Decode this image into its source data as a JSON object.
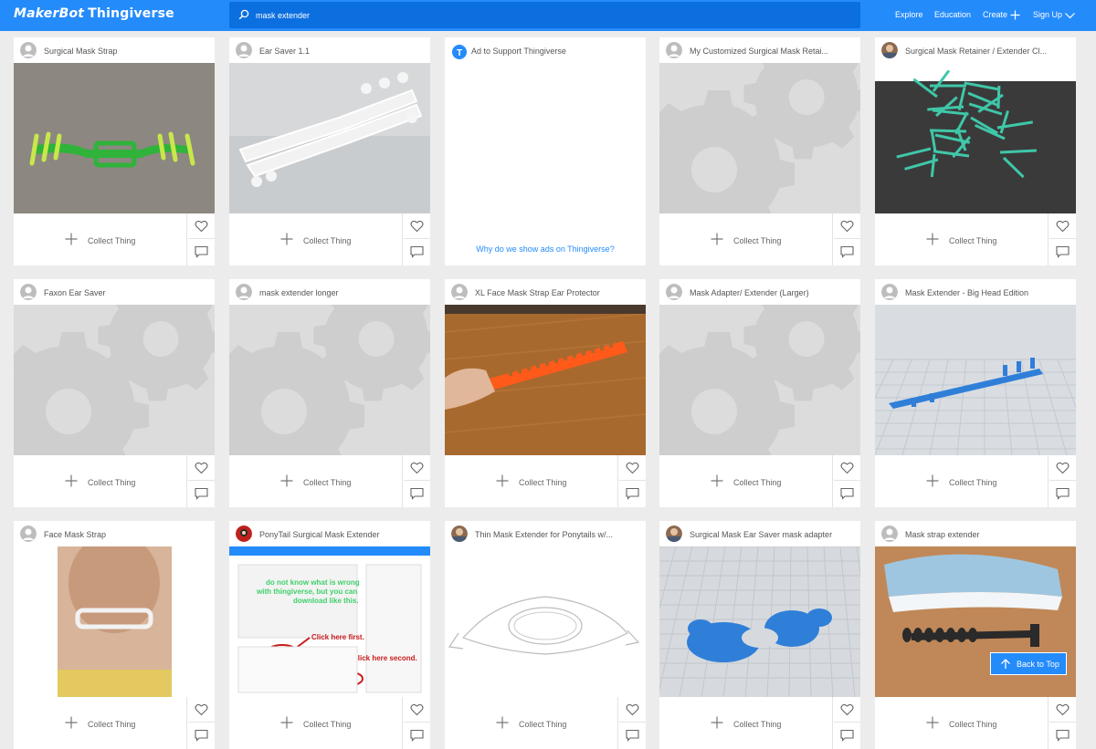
{
  "header": {
    "logo_part1": "MakerBot",
    "logo_part2": "Thingiverse",
    "search_value": "mask extender",
    "nav": [
      "Explore",
      "Education",
      "Create",
      "Sign Up"
    ]
  },
  "collect_label": "Collect Thing",
  "cards": [
    {
      "title": "Surgical Mask Strap",
      "avatar": "default-avatar",
      "image": "green-mask-strap-photo"
    },
    {
      "title": "Ear Saver 1.1",
      "avatar": "default-avatar",
      "image": "white-ear-saver-render"
    },
    {
      "title": "Ad to Support Thingiverse",
      "avatar": "thingiverse-t-logo",
      "image": "ad",
      "ad_link": "Why do we show ads on Thingiverse?"
    },
    {
      "title": "My Customized Surgical Mask Retai...",
      "avatar": "default-avatar",
      "image": "gear-placeholder"
    },
    {
      "title": "Surgical Mask Retainer / Extender Cl...",
      "avatar": "photo-avatar",
      "image": "teal-clips-photo"
    },
    {
      "title": "Faxon Ear Saver",
      "avatar": "default-avatar",
      "image": "gear-placeholder"
    },
    {
      "title": "mask extender longer",
      "avatar": "default-avatar",
      "image": "gear-placeholder"
    },
    {
      "title": "XL Face Mask Strap Ear Protector",
      "avatar": "default-avatar",
      "image": "orange-strap-photo"
    },
    {
      "title": "Mask Adapter/ Extender (Larger)",
      "avatar": "default-avatar",
      "image": "gear-placeholder"
    },
    {
      "title": "Mask Extender - Big Head Edition",
      "avatar": "default-avatar",
      "image": "blue-strap-render"
    },
    {
      "title": "Face Mask Strap",
      "avatar": "default-avatar",
      "image": "neck-strap-photo"
    },
    {
      "title": "PonyTail Surgical Mask Extender",
      "avatar": "red-avatar",
      "image": "screenshot-tutorial"
    },
    {
      "title": "Thin Mask Extender for Ponytails w/...",
      "avatar": "photo-avatar",
      "image": "outline-extender-render"
    },
    {
      "title": "Surgical Mask Ear Saver mask adapter",
      "avatar": "photo-avatar",
      "image": "blue-adapter-render"
    },
    {
      "title": "Mask strap extender",
      "avatar": "default-avatar",
      "image": "mask-with-extender-photo"
    }
  ],
  "tutorial_text": {
    "line1": "do not know what is wrong",
    "line2": "with thingiverse, but you can",
    "line3": "download like this.",
    "click_first": "Click here first.",
    "click_second": "Click here second."
  },
  "back_to_top": "Back to Top",
  "colors": {
    "header": "#248bfb",
    "search": "#0c6fe0",
    "link": "#248bfb"
  }
}
